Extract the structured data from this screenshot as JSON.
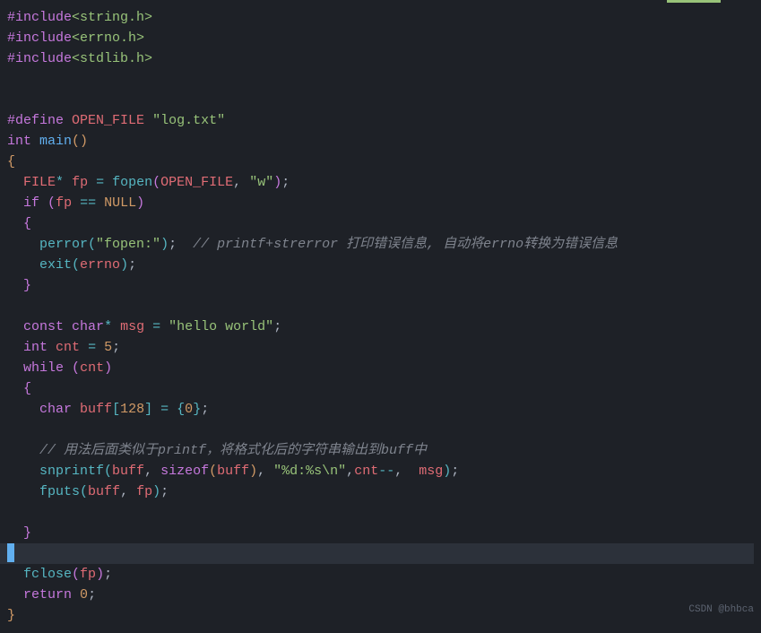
{
  "code": {
    "lines": [
      {
        "tokens": [
          {
            "t": "#include",
            "c": "kw-preproc"
          },
          {
            "t": "<string.h>",
            "c": "header-name"
          }
        ]
      },
      {
        "tokens": [
          {
            "t": "#include",
            "c": "kw-preproc"
          },
          {
            "t": "<errno.h>",
            "c": "header-name"
          }
        ]
      },
      {
        "tokens": [
          {
            "t": "#include",
            "c": "kw-preproc"
          },
          {
            "t": "<stdlib.h>",
            "c": "header-name"
          }
        ]
      },
      {
        "tokens": []
      },
      {
        "tokens": []
      },
      {
        "tokens": [
          {
            "t": "#define",
            "c": "kw-preproc"
          },
          {
            "t": " ",
            "c": "punct"
          },
          {
            "t": "OPEN_FILE",
            "c": "define-name"
          },
          {
            "t": " ",
            "c": "punct"
          },
          {
            "t": "\"log.txt\"",
            "c": "str"
          }
        ]
      },
      {
        "tokens": [
          {
            "t": "int",
            "c": "kw-type"
          },
          {
            "t": " ",
            "c": "punct"
          },
          {
            "t": "main",
            "c": "fn-name"
          },
          {
            "t": "()",
            "c": "paren"
          }
        ]
      },
      {
        "tokens": [
          {
            "t": "{",
            "c": "paren"
          }
        ]
      },
      {
        "tokens": [
          {
            "t": "  ",
            "c": "punct"
          },
          {
            "t": "FILE",
            "c": "var"
          },
          {
            "t": "*",
            "c": "op"
          },
          {
            "t": " ",
            "c": "punct"
          },
          {
            "t": "fp",
            "c": "var"
          },
          {
            "t": " ",
            "c": "punct"
          },
          {
            "t": "=",
            "c": "op"
          },
          {
            "t": " ",
            "c": "punct"
          },
          {
            "t": "fopen",
            "c": "fn-call"
          },
          {
            "t": "(",
            "c": "bracket"
          },
          {
            "t": "OPEN_FILE",
            "c": "var"
          },
          {
            "t": ", ",
            "c": "punct"
          },
          {
            "t": "\"w\"",
            "c": "str"
          },
          {
            "t": ")",
            "c": "bracket"
          },
          {
            "t": ";",
            "c": "punct"
          }
        ]
      },
      {
        "tokens": [
          {
            "t": "  ",
            "c": "punct"
          },
          {
            "t": "if",
            "c": "kw-control"
          },
          {
            "t": " ",
            "c": "punct"
          },
          {
            "t": "(",
            "c": "bracket"
          },
          {
            "t": "fp",
            "c": "var"
          },
          {
            "t": " ",
            "c": "punct"
          },
          {
            "t": "==",
            "c": "op"
          },
          {
            "t": " ",
            "c": "punct"
          },
          {
            "t": "NULL",
            "c": "const-val"
          },
          {
            "t": ")",
            "c": "bracket"
          }
        ]
      },
      {
        "tokens": [
          {
            "t": "  ",
            "c": "punct"
          },
          {
            "t": "{",
            "c": "bracket"
          }
        ]
      },
      {
        "tokens": [
          {
            "t": "    ",
            "c": "punct"
          },
          {
            "t": "perror",
            "c": "fn-call"
          },
          {
            "t": "(",
            "c": "brace"
          },
          {
            "t": "\"fopen:\"",
            "c": "str"
          },
          {
            "t": ")",
            "c": "brace"
          },
          {
            "t": ";  ",
            "c": "punct"
          },
          {
            "t": "// printf+strerror 打印错误信息, 自动将errno转换为错误信息",
            "c": "comment"
          }
        ]
      },
      {
        "tokens": [
          {
            "t": "    ",
            "c": "punct"
          },
          {
            "t": "exit",
            "c": "fn-call"
          },
          {
            "t": "(",
            "c": "brace"
          },
          {
            "t": "errno",
            "c": "var"
          },
          {
            "t": ")",
            "c": "brace"
          },
          {
            "t": ";",
            "c": "punct"
          }
        ]
      },
      {
        "tokens": [
          {
            "t": "  ",
            "c": "punct"
          },
          {
            "t": "}",
            "c": "bracket"
          }
        ]
      },
      {
        "tokens": []
      },
      {
        "tokens": [
          {
            "t": "  ",
            "c": "punct"
          },
          {
            "t": "const",
            "c": "kw-const"
          },
          {
            "t": " ",
            "c": "punct"
          },
          {
            "t": "char",
            "c": "kw-type"
          },
          {
            "t": "*",
            "c": "op"
          },
          {
            "t": " ",
            "c": "punct"
          },
          {
            "t": "msg",
            "c": "var"
          },
          {
            "t": " ",
            "c": "punct"
          },
          {
            "t": "=",
            "c": "op"
          },
          {
            "t": " ",
            "c": "punct"
          },
          {
            "t": "\"hello world\"",
            "c": "str"
          },
          {
            "t": ";",
            "c": "punct"
          }
        ]
      },
      {
        "tokens": [
          {
            "t": "  ",
            "c": "punct"
          },
          {
            "t": "int",
            "c": "kw-type"
          },
          {
            "t": " ",
            "c": "punct"
          },
          {
            "t": "cnt",
            "c": "var"
          },
          {
            "t": " ",
            "c": "punct"
          },
          {
            "t": "=",
            "c": "op"
          },
          {
            "t": " ",
            "c": "punct"
          },
          {
            "t": "5",
            "c": "num"
          },
          {
            "t": ";",
            "c": "punct"
          }
        ]
      },
      {
        "tokens": [
          {
            "t": "  ",
            "c": "punct"
          },
          {
            "t": "while",
            "c": "kw-control"
          },
          {
            "t": " ",
            "c": "punct"
          },
          {
            "t": "(",
            "c": "bracket"
          },
          {
            "t": "cnt",
            "c": "var"
          },
          {
            "t": ")",
            "c": "bracket"
          }
        ]
      },
      {
        "tokens": [
          {
            "t": "  ",
            "c": "punct"
          },
          {
            "t": "{",
            "c": "bracket"
          }
        ]
      },
      {
        "tokens": [
          {
            "t": "    ",
            "c": "punct"
          },
          {
            "t": "char",
            "c": "kw-type"
          },
          {
            "t": " ",
            "c": "punct"
          },
          {
            "t": "buff",
            "c": "var"
          },
          {
            "t": "[",
            "c": "brace"
          },
          {
            "t": "128",
            "c": "num"
          },
          {
            "t": "]",
            "c": "brace"
          },
          {
            "t": " ",
            "c": "punct"
          },
          {
            "t": "=",
            "c": "op"
          },
          {
            "t": " ",
            "c": "punct"
          },
          {
            "t": "{",
            "c": "brace"
          },
          {
            "t": "0",
            "c": "num"
          },
          {
            "t": "}",
            "c": "brace"
          },
          {
            "t": ";",
            "c": "punct"
          }
        ]
      },
      {
        "tokens": []
      },
      {
        "tokens": [
          {
            "t": "    ",
            "c": "punct"
          },
          {
            "t": "// 用法后面类似于printf，将格式化后的字符串输出到buff中",
            "c": "comment"
          }
        ]
      },
      {
        "tokens": [
          {
            "t": "    ",
            "c": "punct"
          },
          {
            "t": "snprintf",
            "c": "fn-call"
          },
          {
            "t": "(",
            "c": "brace"
          },
          {
            "t": "buff",
            "c": "var"
          },
          {
            "t": ", ",
            "c": "punct"
          },
          {
            "t": "sizeof",
            "c": "kw-control"
          },
          {
            "t": "(",
            "c": "paren"
          },
          {
            "t": "buff",
            "c": "var"
          },
          {
            "t": ")",
            "c": "paren"
          },
          {
            "t": ", ",
            "c": "punct"
          },
          {
            "t": "\"%d:%s\\n\"",
            "c": "str"
          },
          {
            "t": ",",
            "c": "punct"
          },
          {
            "t": "cnt",
            "c": "var"
          },
          {
            "t": "--",
            "c": "op"
          },
          {
            "t": ",  ",
            "c": "punct"
          },
          {
            "t": "msg",
            "c": "var"
          },
          {
            "t": ")",
            "c": "brace"
          },
          {
            "t": ";",
            "c": "punct"
          }
        ]
      },
      {
        "tokens": [
          {
            "t": "    ",
            "c": "punct"
          },
          {
            "t": "fputs",
            "c": "fn-call"
          },
          {
            "t": "(",
            "c": "brace"
          },
          {
            "t": "buff",
            "c": "var"
          },
          {
            "t": ", ",
            "c": "punct"
          },
          {
            "t": "fp",
            "c": "var"
          },
          {
            "t": ")",
            "c": "brace"
          },
          {
            "t": ";",
            "c": "punct"
          }
        ]
      },
      {
        "tokens": []
      },
      {
        "tokens": [
          {
            "t": "  ",
            "c": "punct"
          },
          {
            "t": "}",
            "c": "bracket"
          }
        ]
      },
      {
        "tokens": [],
        "highlight": true,
        "cursor": true
      },
      {
        "tokens": [
          {
            "t": "  ",
            "c": "punct"
          },
          {
            "t": "fclose",
            "c": "fn-call"
          },
          {
            "t": "(",
            "c": "bracket"
          },
          {
            "t": "fp",
            "c": "var"
          },
          {
            "t": ")",
            "c": "bracket"
          },
          {
            "t": ";",
            "c": "punct"
          }
        ]
      },
      {
        "tokens": [
          {
            "t": "  ",
            "c": "punct"
          },
          {
            "t": "return",
            "c": "kw-control"
          },
          {
            "t": " ",
            "c": "punct"
          },
          {
            "t": "0",
            "c": "num"
          },
          {
            "t": ";",
            "c": "punct"
          }
        ]
      },
      {
        "tokens": [
          {
            "t": "}",
            "c": "paren"
          }
        ]
      }
    ]
  },
  "watermark": "CSDN @bhbca"
}
